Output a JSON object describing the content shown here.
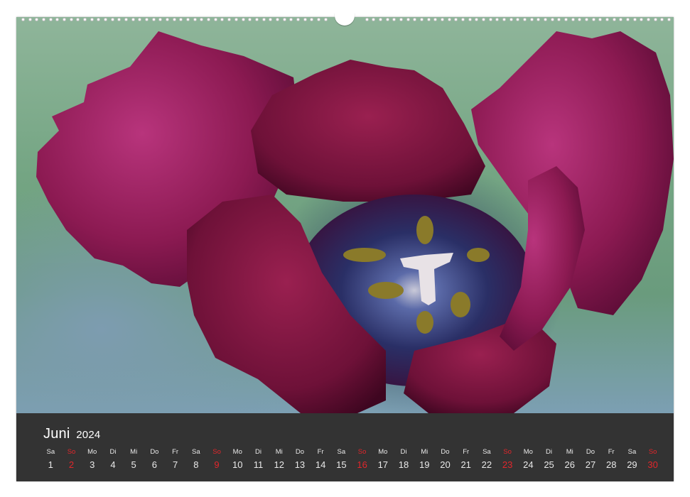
{
  "calendar": {
    "month": "Juni",
    "year": "2024",
    "day_names": [
      "Sa",
      "So",
      "Mo",
      "Di",
      "Mi",
      "Do",
      "Fr",
      "Sa",
      "So",
      "Mo",
      "Di",
      "Mi",
      "Do",
      "Fr",
      "Sa",
      "So",
      "Mo",
      "Di",
      "Mi",
      "Do",
      "Fr",
      "Sa",
      "So",
      "Mo",
      "Di",
      "Mi",
      "Do",
      "Fr",
      "Sa",
      "So"
    ],
    "day_numbers": [
      "1",
      "2",
      "3",
      "4",
      "5",
      "6",
      "7",
      "8",
      "9",
      "10",
      "11",
      "12",
      "13",
      "14",
      "15",
      "16",
      "17",
      "18",
      "19",
      "20",
      "21",
      "22",
      "23",
      "24",
      "25",
      "26",
      "27",
      "28",
      "29",
      "30"
    ],
    "sunday_color": "#e2262b",
    "bar_color": "#333333"
  },
  "photo": {
    "subject": "tulip-flower-icon",
    "colors": {
      "petal": "#8c1a52",
      "petal_light": "#b8347c",
      "center": "#2a2f66",
      "background": "#74a583"
    }
  }
}
